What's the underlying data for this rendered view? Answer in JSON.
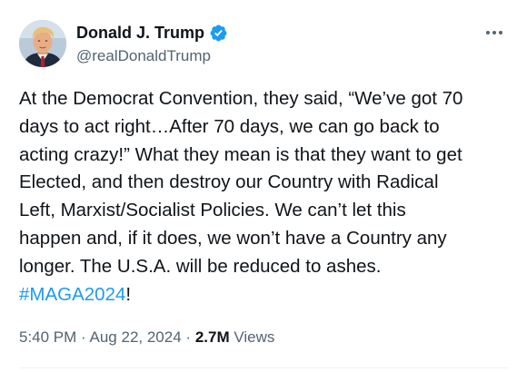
{
  "author": {
    "display_name": "Donald J. Trump",
    "handle": "@realDonaldTrump",
    "verified": true,
    "verified_color": "#1d9bf0"
  },
  "icons": {
    "verified": "verified-badge-icon",
    "more": "more-options-icon",
    "avatar": "profile-photo"
  },
  "tweet": {
    "text": "At the Democrat Convention, they said, “We’ve got 70\ndays to act right…After 70 days, we can go back to\nacting crazy!” What they mean is that they want to get\nElected, and then destroy our Country with Radical\nLeft, Marxist/Socialist Policies. We can’t let this\nhappen and, if it does, we won’t have a Country any\nlonger. The U.S.A. will be reduced to ashes.\n",
    "hashtag": "#MAGA2024",
    "trailing": "!"
  },
  "meta": {
    "time": "5:40 PM",
    "separator": "·",
    "date": "Aug 22, 2024",
    "views_count": "2.7M",
    "views_label": "Views"
  },
  "colors": {
    "text": "#0f1419",
    "secondary": "#536471",
    "accent": "#1d9bf0"
  }
}
